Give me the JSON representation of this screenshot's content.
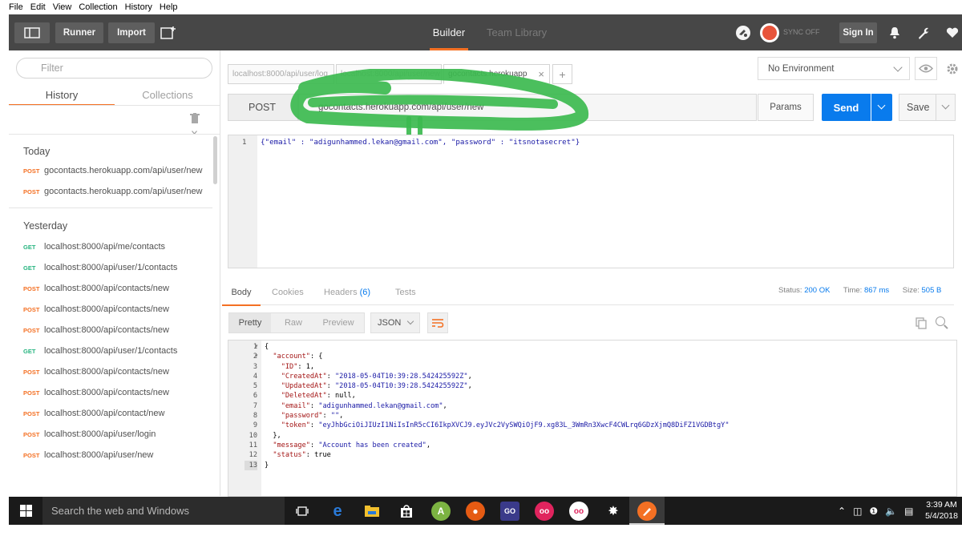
{
  "menubar": [
    "File",
    "Edit",
    "View",
    "Collection",
    "History",
    "Help"
  ],
  "header": {
    "runner_label": "Runner",
    "import_label": "Import",
    "tabs": [
      {
        "label": "Builder",
        "active": true
      },
      {
        "label": "Team Library",
        "active": false
      }
    ],
    "sync_label": "SYNC OFF",
    "signin_label": "Sign In",
    "icons": [
      "sidebar-toggle-icon",
      "new-tab-icon",
      "interceptor-icon",
      "sync-icon",
      "bell-icon",
      "wrench-icon",
      "heart-icon"
    ]
  },
  "sidebar": {
    "filter_placeholder": "Filter",
    "tabs": [
      {
        "label": "History",
        "active": true
      },
      {
        "label": "Collections",
        "active": false
      }
    ],
    "groups": [
      {
        "label": "Today",
        "items": [
          {
            "method": "POST",
            "url": "gocontacts.herokuapp.com/api/user/new"
          },
          {
            "method": "POST",
            "url": "gocontacts.herokuapp.com/api/user/new"
          }
        ]
      },
      {
        "label": "Yesterday",
        "items": [
          {
            "method": "GET",
            "url": "localhost:8000/api/me/contacts"
          },
          {
            "method": "GET",
            "url": "localhost:8000/api/user/1/contacts"
          },
          {
            "method": "POST",
            "url": "localhost:8000/api/contacts/new"
          },
          {
            "method": "POST",
            "url": "localhost:8000/api/contacts/new"
          },
          {
            "method": "POST",
            "url": "localhost:8000/api/contacts/new"
          },
          {
            "method": "GET",
            "url": "localhost:8000/api/user/1/contacts"
          },
          {
            "method": "POST",
            "url": "localhost:8000/api/contacts/new"
          },
          {
            "method": "POST",
            "url": "localhost:8000/api/contacts/new"
          },
          {
            "method": "POST",
            "url": "localhost:8000/api/contact/new"
          },
          {
            "method": "POST",
            "url": "localhost:8000/api/user/login"
          },
          {
            "method": "POST",
            "url": "localhost:8000/api/user/new"
          }
        ]
      }
    ]
  },
  "request_tabs": [
    {
      "label": "localhost:8000/api/user/log",
      "active": false
    },
    {
      "label": "localhost:8000/api/user/new",
      "active": false
    },
    {
      "label": "gocontacts.herokuapp",
      "active": true
    }
  ],
  "environment": {
    "selected": "No Environment"
  },
  "request": {
    "method": "POST",
    "url": "gocontacts.herokuapp.com/api/user/new",
    "params_label": "Params",
    "send_label": "Send",
    "save_label": "Save",
    "body_line_number": "1",
    "body": "{\"email\" : \"adigunhammed.lekan@gmail.com\", \"password\" : \"itsnotasecret\"}"
  },
  "response": {
    "tabs": [
      {
        "label": "Body",
        "active": true
      },
      {
        "label": "Cookies"
      },
      {
        "label": "Headers",
        "count": "(6)"
      },
      {
        "label": "Tests"
      }
    ],
    "status_label": "Status:",
    "status_value": "200 OK",
    "time_label": "Time:",
    "time_value": "867 ms",
    "size_label": "Size:",
    "size_value": "505 B",
    "formats": [
      "Pretty",
      "Raw",
      "Preview"
    ],
    "format_select": "JSON",
    "lines": [
      "{",
      "  \"account\": {",
      "    \"ID\": 1,",
      "    \"CreatedAt\": \"2018-05-04T10:39:28.542425592Z\",",
      "    \"UpdatedAt\": \"2018-05-04T10:39:28.542425592Z\",",
      "    \"DeletedAt\": null,",
      "    \"email\": \"adigunhammed.lekan@gmail.com\",",
      "    \"password\": \"\",",
      "    \"token\": \"eyJhbGciOiJIUzI1NiIsInR5cCI6IkpXVCJ9.eyJVc2VySWQiOjF9.xg83L_3WmRn3XwcF4CWLrq6GDzXjmQ8DiFZ1VGDBtgY\"",
      "  },",
      "  \"message\": \"Account has been created\",",
      "  \"status\": true",
      "}"
    ]
  },
  "taskbar": {
    "search_placeholder": "Search the web and Windows",
    "time": "3:39 AM",
    "date": "5/4/2018",
    "colors": {
      "accent": "#f47023",
      "send": "#097bed",
      "get": "#26b47f"
    }
  }
}
